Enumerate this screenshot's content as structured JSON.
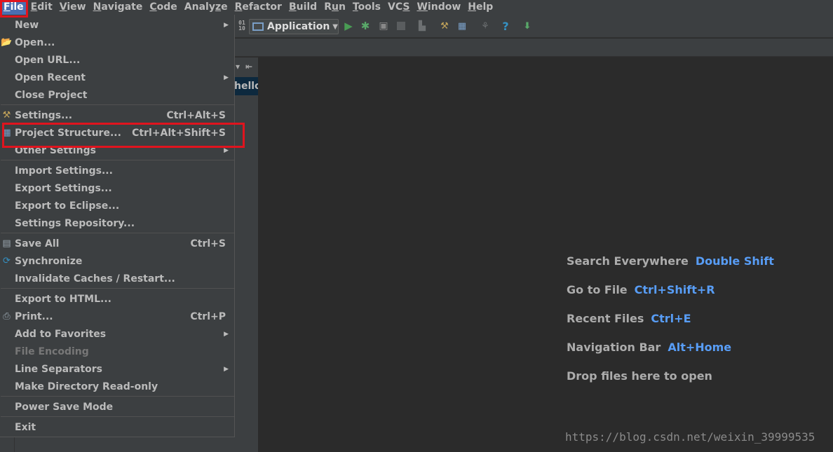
{
  "menubar": {
    "items": [
      {
        "mn": "F",
        "rest": "ile"
      },
      {
        "mn": "E",
        "rest": "dit"
      },
      {
        "mn": "V",
        "rest": "iew"
      },
      {
        "mn": "N",
        "rest": "avigate"
      },
      {
        "mn": "C",
        "rest": "ode"
      },
      {
        "pre": "Analy",
        "mn": "z",
        "rest": "e"
      },
      {
        "mn": "R",
        "rest": "efactor"
      },
      {
        "mn": "B",
        "rest": "uild"
      },
      {
        "pre": "R",
        "mn": "u",
        "rest": "n"
      },
      {
        "mn": "T",
        "rest": "ools"
      },
      {
        "pre": "VC",
        "mn": "S",
        "rest": ""
      },
      {
        "mn": "W",
        "rest": "indow"
      },
      {
        "mn": "H",
        "rest": "elp"
      }
    ]
  },
  "toolbar": {
    "run_config": "Application"
  },
  "project_tab": "hello",
  "file_menu": {
    "items": [
      {
        "label": "New",
        "shortcut": "",
        "submenu": true,
        "icon": ""
      },
      {
        "label": "Open...",
        "shortcut": "",
        "submenu": false,
        "icon": "folder-icon"
      },
      {
        "label": "Open URL...",
        "shortcut": "",
        "submenu": false,
        "icon": ""
      },
      {
        "label": "Open Recent",
        "shortcut": "",
        "submenu": true,
        "icon": ""
      },
      {
        "label": "Close Project",
        "shortcut": "",
        "submenu": false,
        "icon": ""
      },
      {
        "label": "Settings...",
        "shortcut": "Ctrl+Alt+S",
        "submenu": false,
        "icon": "wrench-icon"
      },
      {
        "label": "Project Structure...",
        "shortcut": "Ctrl+Alt+Shift+S",
        "submenu": false,
        "icon": "project-structure-icon"
      },
      {
        "label": "Other Settings",
        "shortcut": "",
        "submenu": true,
        "icon": ""
      },
      {
        "label": "Import Settings...",
        "shortcut": "",
        "submenu": false,
        "icon": ""
      },
      {
        "label": "Export Settings...",
        "shortcut": "",
        "submenu": false,
        "icon": ""
      },
      {
        "label": "Export to Eclipse...",
        "shortcut": "",
        "submenu": false,
        "icon": ""
      },
      {
        "label": "Settings Repository...",
        "shortcut": "",
        "submenu": false,
        "icon": ""
      },
      {
        "label": "Save All",
        "shortcut": "Ctrl+S",
        "submenu": false,
        "icon": "save-icon"
      },
      {
        "label": "Synchronize",
        "shortcut": "",
        "submenu": false,
        "icon": "sync-icon"
      },
      {
        "label": "Invalidate Caches / Restart...",
        "shortcut": "",
        "submenu": false,
        "icon": ""
      },
      {
        "label": "Export to HTML...",
        "shortcut": "",
        "submenu": false,
        "icon": ""
      },
      {
        "label": "Print...",
        "shortcut": "Ctrl+P",
        "submenu": false,
        "icon": "printer-icon"
      },
      {
        "label": "Add to Favorites",
        "shortcut": "",
        "submenu": true,
        "icon": ""
      },
      {
        "label": "File Encoding",
        "shortcut": "",
        "submenu": false,
        "icon": "",
        "disabled": true
      },
      {
        "label": "Line Separators",
        "shortcut": "",
        "submenu": true,
        "icon": ""
      },
      {
        "label": "Make Directory Read-only",
        "shortcut": "",
        "submenu": false,
        "icon": ""
      },
      {
        "label": "Power Save Mode",
        "shortcut": "",
        "submenu": false,
        "icon": ""
      },
      {
        "label": "Exit",
        "shortcut": "",
        "submenu": false,
        "icon": ""
      }
    ]
  },
  "editor_hints": {
    "search_label": "Search Everywhere",
    "search_key": "Double Shift",
    "goto_label": "Go to File",
    "goto_key": "Ctrl+Shift+R",
    "recent_label": "Recent Files",
    "recent_key": "Ctrl+E",
    "nav_label": "Navigation Bar",
    "nav_key": "Alt+Home",
    "drop_label": "Drop files here to open"
  },
  "watermark": "https://blog.csdn.net/weixin_39999535",
  "colors": {
    "menu_bg": "#3c3f41",
    "editor_bg": "#2b2b2b",
    "accent_key": "#589df6",
    "highlight_box": "#e0141e",
    "selected_menu": "#4b6eaf"
  }
}
